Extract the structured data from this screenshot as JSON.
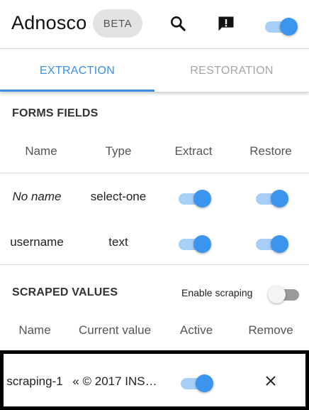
{
  "header": {
    "title": "Adnosco",
    "badge": "BETA",
    "icons": [
      "search-icon",
      "feedback-icon"
    ],
    "master_toggle": true
  },
  "tabs": [
    {
      "label": "EXTRACTION",
      "active": true
    },
    {
      "label": "RESTORATION",
      "active": false
    }
  ],
  "forms_fields": {
    "title": "FORMS FIELDS",
    "columns": [
      "Name",
      "Type",
      "Extract",
      "Restore"
    ],
    "rows": [
      {
        "name": "No name",
        "type": "select-one",
        "extract": true,
        "restore": true
      },
      {
        "name": "username",
        "type": "text",
        "extract": true,
        "restore": true
      }
    ]
  },
  "scraped_values": {
    "title": "SCRAPED VALUES",
    "enable_label": "Enable scraping",
    "enable_scraping": false,
    "columns": [
      "Name",
      "Current value",
      "Active",
      "Remove"
    ],
    "rows": [
      {
        "name": "scraping-1",
        "current_value": "« © 2017 INS…",
        "active": true
      }
    ]
  },
  "colors": {
    "accent": "#3b8fe3",
    "toggle_on_thumb": "#3b95ee",
    "toggle_on_track": "#a8cff8"
  }
}
